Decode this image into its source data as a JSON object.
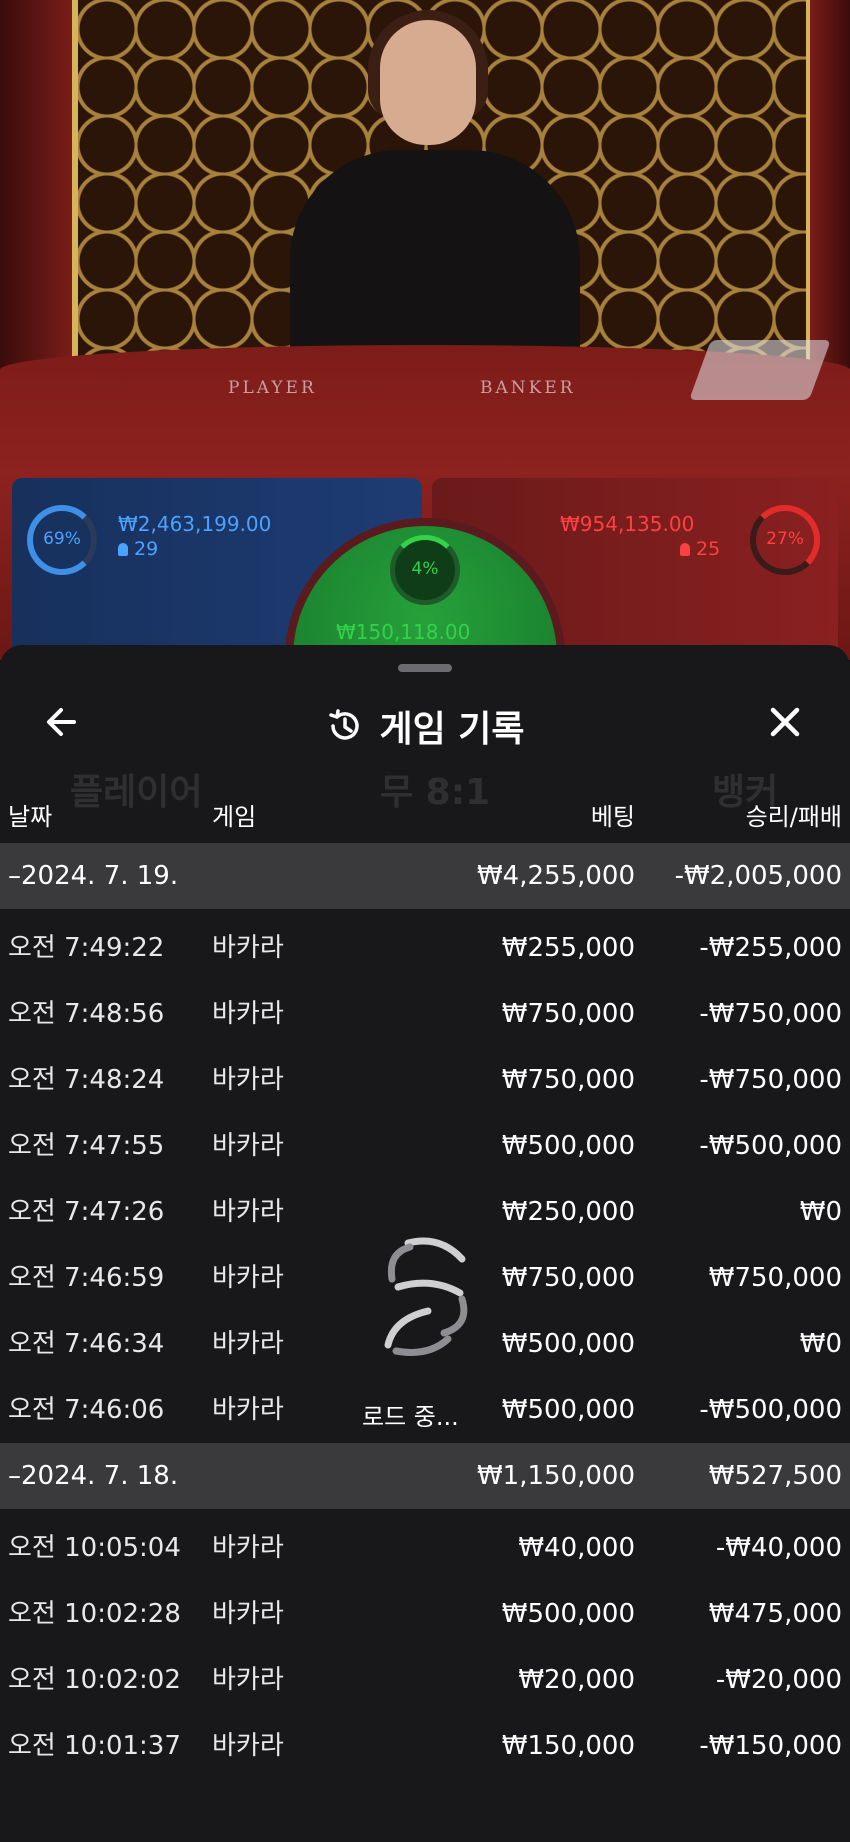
{
  "video": {
    "felt_player": "PLAYER",
    "felt_banker": "BANKER",
    "player": {
      "percent": "69%",
      "amount": "₩2,463,199.00",
      "count": "29",
      "color": "#4aa3ff"
    },
    "banker": {
      "percent": "27%",
      "amount": "₩954,135.00",
      "count": "25",
      "color": "#ff4040"
    },
    "tie": {
      "percent": "4%",
      "amount": "₩150,118.00",
      "color": "#33d24b"
    }
  },
  "background_text": {
    "player": "플레이어",
    "tie": "무 8:1",
    "banker": "뱅커"
  },
  "sheet": {
    "title": "게임 기록",
    "history_icon": "history-icon",
    "back_icon": "arrow-left-icon",
    "close_icon": "close-icon",
    "columns": {
      "date": "날짜",
      "game": "게임",
      "bet": "베팅",
      "result": "승리/패배"
    },
    "loading": "로드 중..."
  },
  "groups": [
    {
      "date": "–2024. 7. 19.",
      "bet": "₩4,255,000",
      "result": "-₩2,005,000",
      "records": [
        {
          "time": "오전 7:49:22",
          "game": "바카라",
          "bet": "₩255,000",
          "result": "-₩255,000"
        },
        {
          "time": "오전 7:48:56",
          "game": "바카라",
          "bet": "₩750,000",
          "result": "-₩750,000"
        },
        {
          "time": "오전 7:48:24",
          "game": "바카라",
          "bet": "₩750,000",
          "result": "-₩750,000"
        },
        {
          "time": "오전 7:47:55",
          "game": "바카라",
          "bet": "₩500,000",
          "result": "-₩500,000"
        },
        {
          "time": "오전 7:47:26",
          "game": "바카라",
          "bet": "₩250,000",
          "result": "₩0"
        },
        {
          "time": "오전 7:46:59",
          "game": "바카라",
          "bet": "₩750,000",
          "result": "₩750,000"
        },
        {
          "time": "오전 7:46:34",
          "game": "바카라",
          "bet": "₩500,000",
          "result": "₩0"
        },
        {
          "time": "오전 7:46:06",
          "game": "바카라",
          "bet": "₩500,000",
          "result": "-₩500,000"
        }
      ]
    },
    {
      "date": "–2024. 7. 18.",
      "bet": "₩1,150,000",
      "result": "₩527,500",
      "records": [
        {
          "time": "오전 10:05:04",
          "game": "바카라",
          "bet": "₩40,000",
          "result": "-₩40,000"
        },
        {
          "time": "오전 10:02:28",
          "game": "바카라",
          "bet": "₩500,000",
          "result": "₩475,000"
        },
        {
          "time": "오전 10:02:02",
          "game": "바카라",
          "bet": "₩20,000",
          "result": "-₩20,000"
        },
        {
          "time": "오전 10:01:37",
          "game": "바카라",
          "bet": "₩150,000",
          "result": "-₩150,000"
        }
      ]
    }
  ]
}
